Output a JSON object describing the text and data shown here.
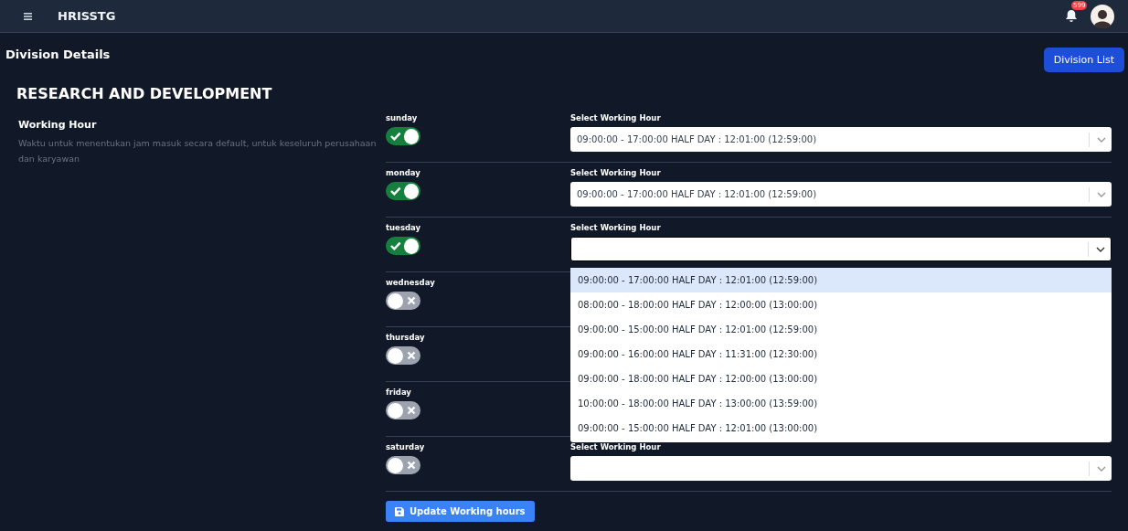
{
  "header": {
    "app_name": "HRISSTG",
    "notification_count": "599"
  },
  "page": {
    "title": "Division Details",
    "list_button": "Division List"
  },
  "division": {
    "name": "RESEARCH AND DEVELOPMENT"
  },
  "section": {
    "title": "Working Hour",
    "description": "Waktu untuk menentukan jam masuk secara default, untuk keseluruh perusahaan dan karyawan"
  },
  "days": [
    {
      "label": "sunday",
      "on": true,
      "select": {
        "label": "Select Working Hour",
        "value": "09:00:00 - 17:00:00 HALF DAY : 12:01:00 (12:59:00)",
        "expanded": false
      }
    },
    {
      "label": "monday",
      "on": true,
      "select": {
        "label": "Select Working Hour",
        "value": "09:00:00 - 17:00:00 HALF DAY : 12:01:00 (12:59:00)",
        "expanded": false
      }
    },
    {
      "label": "tuesday",
      "on": true,
      "select": {
        "label": "Select Working Hour",
        "expanded": true,
        "options": [
          {
            "text": "09:00:00 - 17:00:00 HALF DAY : 12:01:00 (12:59:00)",
            "selected": true
          },
          {
            "text": "08:00:00 - 18:00:00 HALF DAY : 12:00:00 (13:00:00)",
            "selected": false
          },
          {
            "text": "09:00:00 - 15:00:00 HALF DAY : 12:01:00 (12:59:00)",
            "selected": false
          },
          {
            "text": "09:00:00 - 16:00:00 HALF DAY : 11:31:00 (12:30:00)",
            "selected": false
          },
          {
            "text": "09:00:00 - 18:00:00 HALF DAY : 12:00:00 (13:00:00)",
            "selected": false
          },
          {
            "text": "10:00:00 - 18:00:00 HALF DAY : 13:00:00 (13:59:00)",
            "selected": false
          },
          {
            "text": "09:00:00 - 15:00:00 HALF DAY : 12:01:00 (13:00:00)",
            "selected": false
          }
        ]
      }
    },
    {
      "label": "wednesday",
      "on": false
    },
    {
      "label": "thursday",
      "on": false
    },
    {
      "label": "friday",
      "on": false
    },
    {
      "label": "saturday",
      "on": false,
      "select": {
        "label": "Select Working Hour",
        "expanded": false
      }
    }
  ],
  "update_button": "Update Working hours"
}
